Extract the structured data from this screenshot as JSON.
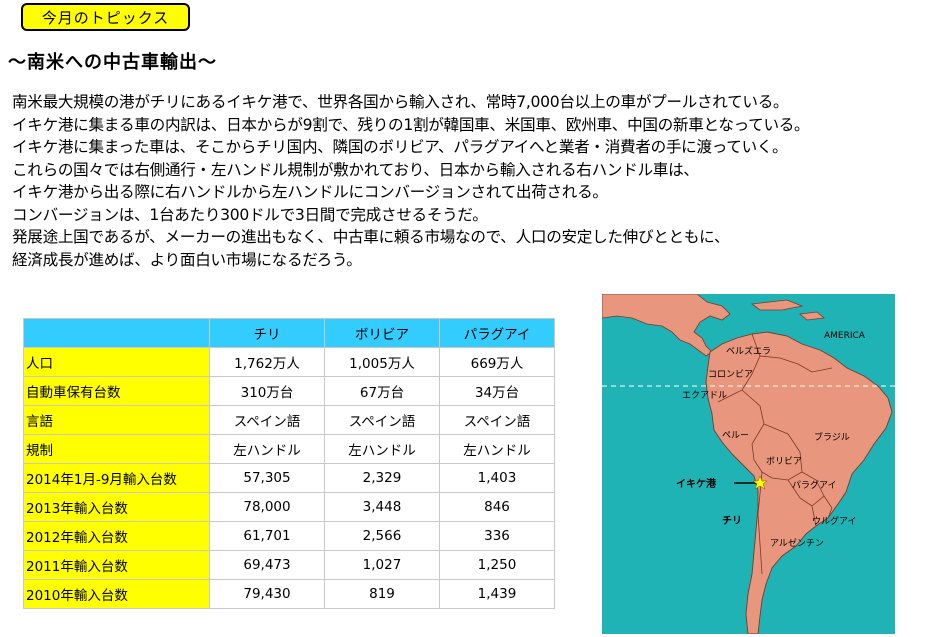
{
  "header": {
    "badge": "今月のトピックス",
    "subtitle": "～南米への中古車輸出～"
  },
  "body": {
    "paragraphs": [
      "南米最大規模の港がチリにあるイキケ港で、世界各国から輸入され、常時7,000台以上の車がプールされている。",
      "イキケ港に集まる車の内訳は、日本からが9割で、残りの1割が韓国車、米国車、欧州車、中国の新車となっている。",
      "イキケ港に集まった車は、そこからチリ国内、隣国のボリビア、パラグアイへと業者・消費者の手に渡っていく。",
      "これらの国々では右側通行・左ハンドル規制が敷かれており、日本から輸入される右ハンドル車は、",
      "イキケ港から出る際に右ハンドルから左ハンドルにコンバージョンされて出荷される。",
      "コンバージョンは、1台あたり300ドルで3日間で完成させるそうだ。",
      "発展途上国であるが、メーカーの進出もなく、中古車に頼る市場なので、人口の安定した伸びとともに、",
      "経済成長が進めば、より面白い市場になるだろう。"
    ]
  },
  "table": {
    "columns": [
      "",
      "チリ",
      "ボリビア",
      "パラグアイ"
    ],
    "rows": [
      {
        "label": "人口",
        "values": [
          "1,762万人",
          "1,005万人",
          "669万人"
        ]
      },
      {
        "label": "自動車保有台数",
        "values": [
          "310万台",
          "67万台",
          "34万台"
        ]
      },
      {
        "label": "言語",
        "values": [
          "スペイン語",
          "スペイン語",
          "スペイン語"
        ]
      },
      {
        "label": "規制",
        "values": [
          "左ハンドル",
          "左ハンドル",
          "左ハンドル"
        ]
      },
      {
        "label": "2014年1月-9月輸入台数",
        "values": [
          "57,305",
          "2,329",
          "1,403"
        ]
      },
      {
        "label": "2013年輸入台数",
        "values": [
          "78,000",
          "3,448",
          "846"
        ]
      },
      {
        "label": "2012年輸入台数",
        "values": [
          "61,701",
          "2,566",
          "336"
        ]
      },
      {
        "label": "2011年輸入台数",
        "values": [
          "69,473",
          "1,027",
          "1,250"
        ]
      },
      {
        "label": "2010年輸入台数",
        "values": [
          "79,430",
          "819",
          "1,439"
        ]
      }
    ]
  },
  "map": {
    "region_label": "AMERICA",
    "port_label": "イキケ港",
    "countries": {
      "venezuela": "ベルズエラ",
      "colombia": "コロンビア",
      "ecuador": "エクアドル",
      "peru": "ペルー",
      "brazil": "ブラジル",
      "bolivia": "ボリビア",
      "paraguay": "パラグアイ",
      "chile": "チリ",
      "uruguay": "ウルグアイ",
      "argentina": "アルゼンチン"
    },
    "colors": {
      "ocean": "#1fb3b6",
      "land": "#e8967d",
      "border": "#7a3a28",
      "highlight": "#ffff00"
    }
  },
  "colors": {
    "badge": "#ffff00",
    "table_header": "#33ccff",
    "table_label": "#ffff00"
  }
}
